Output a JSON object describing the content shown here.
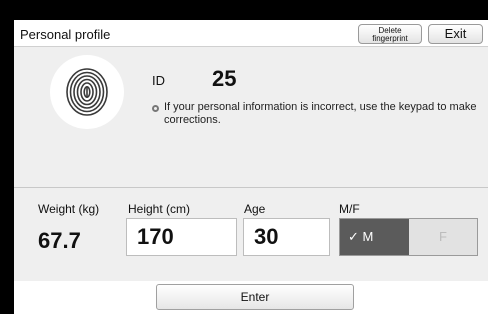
{
  "header": {
    "title": "Personal profile",
    "delete_line1": "Delete",
    "delete_line2": "fingerprint",
    "exit_label": "Exit"
  },
  "profile": {
    "id_label": "ID",
    "id_value": "25",
    "info_text": "If your personal information is incorrect, use the keypad to make corrections.",
    "icon": "fingerprint-icon"
  },
  "fields": {
    "weight_label": "Weight (kg)",
    "weight_value": "67.7",
    "height_label": "Height (cm)",
    "height_value": "170",
    "age_label": "Age",
    "age_value": "30",
    "mf_label": "M/F",
    "male_label": "✓ M",
    "female_label": "F",
    "selected": "M"
  },
  "footer": {
    "enter_label": "Enter"
  },
  "colors": {
    "panel_bg": "#efefef",
    "selected_bg": "#5b5b5b",
    "unselected_bg": "#e2e2e2"
  }
}
